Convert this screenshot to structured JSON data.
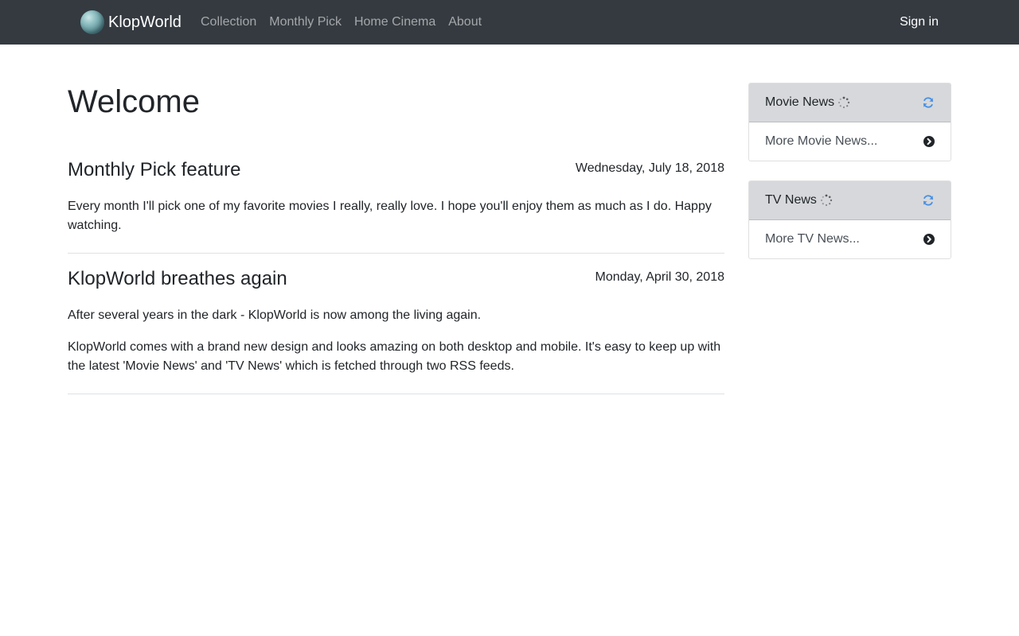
{
  "navbar": {
    "brand": "KlopWorld",
    "links": [
      "Collection",
      "Monthly Pick",
      "Home Cinema",
      "About"
    ],
    "signin": "Sign in"
  },
  "main": {
    "title": "Welcome",
    "posts": [
      {
        "title": "Monthly Pick feature",
        "date": "Wednesday, July 18, 2018",
        "paragraphs": [
          "Every month I'll pick one of my favorite movies I really, really love. I hope you'll enjoy them as much as I do. Happy watching."
        ]
      },
      {
        "title": "KlopWorld breathes again",
        "date": "Monday, April 30, 2018",
        "paragraphs": [
          "After several years in the dark - KlopWorld is now among the living again.",
          "KlopWorld comes with a brand new design and looks amazing on both desktop and mobile. It's easy to keep up with the latest 'Movie News' and 'TV News' which is fetched through two RSS feeds."
        ]
      }
    ]
  },
  "sidebar": {
    "cards": [
      {
        "title": "Movie News",
        "link": "More Movie News..."
      },
      {
        "title": "TV News",
        "link": "More TV News..."
      }
    ]
  },
  "icons": {
    "logo": "globe-logo",
    "spinner": "loading-spinner-icon",
    "refresh": "refresh-icon",
    "chevron": "chevron-circle-right-icon"
  },
  "colors": {
    "navbar_bg": "#343a40",
    "card_header_bg": "#d6d8db",
    "refresh_icon": "#4a90e2"
  }
}
